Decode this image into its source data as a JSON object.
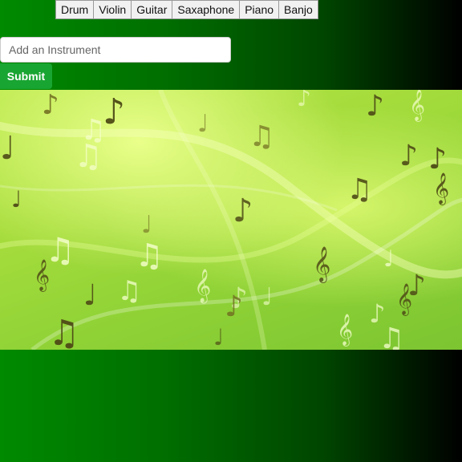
{
  "instruments": [
    "Drum",
    "Violin",
    "Guitar",
    "Saxaphone",
    "Piano",
    "Banjo"
  ],
  "form": {
    "input_placeholder": "Add an Instrument",
    "input_value": "",
    "submit_label": "Submit"
  },
  "banner": {
    "image": "music-notes-background"
  },
  "colors": {
    "accent": "#19a532",
    "background_left": "#008a00",
    "background_right": "#000000",
    "banner": "#a5dc3c"
  }
}
